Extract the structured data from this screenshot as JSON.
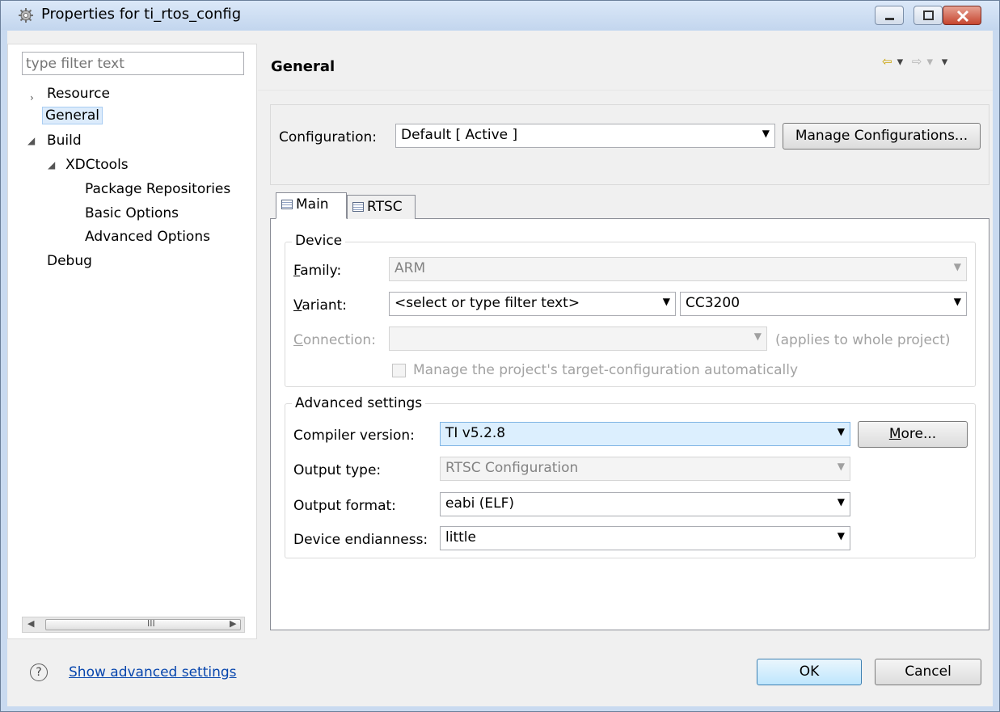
{
  "window": {
    "title": "Properties for ti_rtos_config"
  },
  "sidebar": {
    "filter_placeholder": "type filter text",
    "items": [
      {
        "label": "Resource",
        "arrow": "›"
      },
      {
        "label": "General",
        "selected": true
      },
      {
        "label": "Build",
        "arrow": "◢"
      },
      {
        "label": "XDCtools",
        "arrow": "◢"
      },
      {
        "label": "Package Repositories"
      },
      {
        "label": "Basic Options"
      },
      {
        "label": "Advanced Options"
      },
      {
        "label": "Debug"
      }
    ],
    "scroll_grip": "III"
  },
  "header": {
    "title": "General"
  },
  "configuration": {
    "label": "Configuration:",
    "value": "Default  [ Active ]",
    "manage_button": "Manage Configurations..."
  },
  "tabs": [
    {
      "label": "Main",
      "active": true
    },
    {
      "label": "RTSC",
      "active": false
    }
  ],
  "device": {
    "group_title": "Device",
    "family_label_prefix": "F",
    "family_label_rest": "amily:",
    "family_value": "ARM",
    "variant_label_prefix": "V",
    "variant_label_rest": "ariant:",
    "variant_filter": "<select or type filter text>",
    "variant_value": "CC3200",
    "connection_label_prefix": "C",
    "connection_label_rest": "onnection:",
    "connection_value": "",
    "connection_note": "(applies to whole project)",
    "manage_checkbox_label": "Manage the project's target-configuration automatically"
  },
  "advanced": {
    "group_title": "Advanced settings",
    "compiler_label": "Compiler version:",
    "compiler_value": "TI v5.2.8",
    "more_prefix": "M",
    "more_rest": "ore...",
    "output_type_label": "Output type:",
    "output_type_value": "RTSC Configuration",
    "output_format_label": "Output format:",
    "output_format_value": "eabi (ELF)",
    "endianness_label": "Device endianness:",
    "endianness_value": "little"
  },
  "footer": {
    "help_icon": "?",
    "link": "Show advanced settings",
    "ok": "OK",
    "cancel": "Cancel"
  },
  "icons": {
    "combo_arrow": "▼",
    "nav_back": "⇦",
    "nav_fwd": "⇨",
    "nav_dropdown": "▾"
  },
  "colors": {
    "titlebar": "#c3d6ee",
    "link": "#0645ad",
    "selection": "#dcebfb",
    "close_button": "#c6452f"
  }
}
